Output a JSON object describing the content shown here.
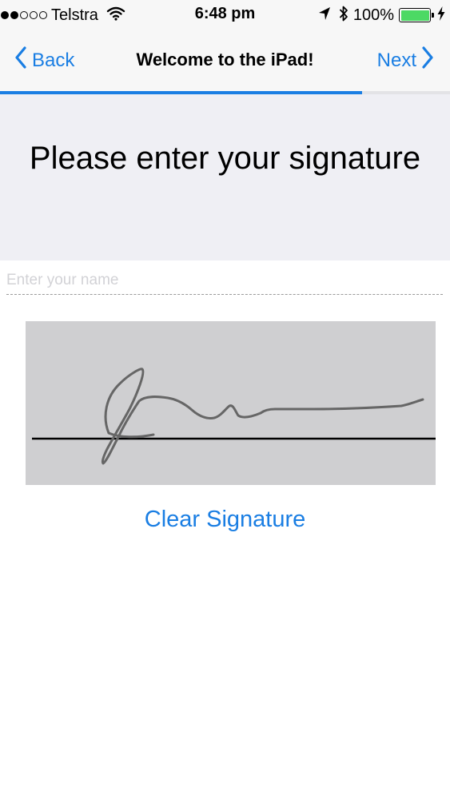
{
  "status_bar": {
    "signal_bars_filled": 2,
    "signal_bars_total": 5,
    "carrier": "Telstra",
    "time": "6:48 pm",
    "battery_percent": "100%",
    "battery_level": 1.0,
    "icons": [
      "wifi-icon",
      "location-arrow-icon",
      "bluetooth-icon",
      "battery-icon",
      "charging-bolt-icon"
    ]
  },
  "nav": {
    "back_label": "Back",
    "title": "Welcome to the iPad!",
    "next_label": "Next",
    "progress": 0.805
  },
  "content": {
    "heading": "Please enter your signature",
    "name_placeholder": "Enter your name",
    "name_value": "",
    "clear_label": "Clear Signature"
  },
  "colors": {
    "accent": "#1a7ee3",
    "heading_bg": "#efeff4",
    "pad_bg": "#cfcfd1",
    "battery_green": "#4cd964"
  }
}
